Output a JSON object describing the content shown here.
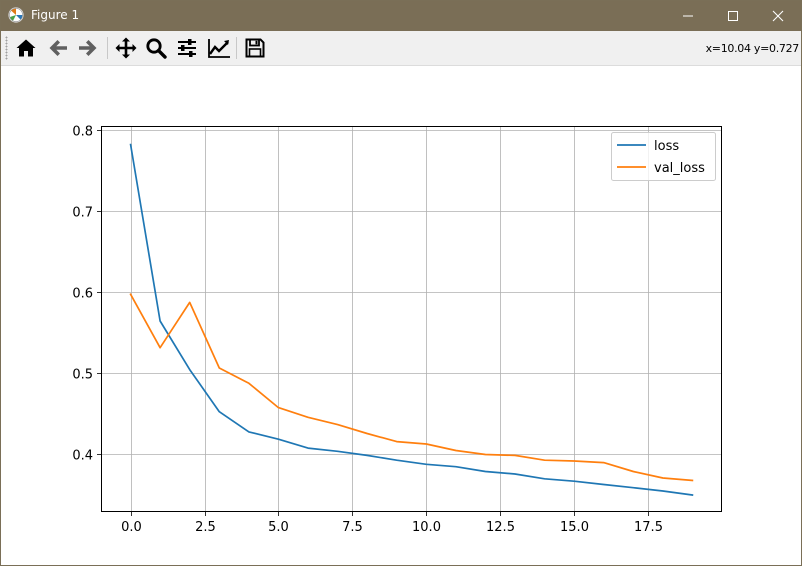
{
  "window": {
    "title": "Figure 1",
    "controls": [
      "minimize",
      "maximize",
      "close"
    ]
  },
  "toolbar": {
    "buttons": [
      {
        "name": "home",
        "icon": "home-icon"
      },
      {
        "name": "back",
        "icon": "arrow-left-icon"
      },
      {
        "name": "forward",
        "icon": "arrow-right-icon"
      },
      {
        "name": "pan",
        "icon": "move-icon"
      },
      {
        "name": "zoom",
        "icon": "zoom-icon"
      },
      {
        "name": "configure-subplots",
        "icon": "sliders-icon"
      },
      {
        "name": "edit-axis",
        "icon": "line-chart-icon"
      },
      {
        "name": "save",
        "icon": "save-icon"
      }
    ],
    "coordinates": "x=10.04 y=0.727"
  },
  "colors": {
    "loss": "#1f77b4",
    "val_loss": "#ff7f0e",
    "grid": "#b0b0b0"
  },
  "chart_data": {
    "type": "line",
    "title": "",
    "xlabel": "",
    "ylabel": "",
    "xlim": [
      -1.0,
      20.0
    ],
    "ylim": [
      0.328,
      0.805
    ],
    "xticks": [
      0.0,
      2.5,
      5.0,
      7.5,
      10.0,
      12.5,
      15.0,
      17.5
    ],
    "xtick_labels": [
      "0.0",
      "2.5",
      "5.0",
      "7.5",
      "10.0",
      "12.5",
      "15.0",
      "17.5"
    ],
    "yticks": [
      0.4,
      0.5,
      0.6,
      0.7,
      0.8
    ],
    "ytick_labels": [
      "0.4",
      "0.5",
      "0.6",
      "0.7",
      "0.8"
    ],
    "grid": true,
    "legend_position": "top-right",
    "x": [
      0,
      1,
      2,
      3,
      4,
      5,
      6,
      7,
      8,
      9,
      10,
      11,
      12,
      13,
      14,
      15,
      16,
      17,
      18,
      19
    ],
    "series": [
      {
        "name": "loss",
        "color": "#1f77b4",
        "values": [
          0.782,
          0.564,
          0.504,
          0.452,
          0.427,
          0.418,
          0.407,
          0.403,
          0.398,
          0.392,
          0.387,
          0.384,
          0.378,
          0.375,
          0.369,
          0.366,
          0.362,
          0.358,
          0.354,
          0.349
        ]
      },
      {
        "name": "val_loss",
        "color": "#ff7f0e",
        "values": [
          0.597,
          0.531,
          0.587,
          0.506,
          0.487,
          0.457,
          0.445,
          0.436,
          0.425,
          0.415,
          0.412,
          0.404,
          0.399,
          0.398,
          0.392,
          0.391,
          0.389,
          0.378,
          0.37,
          0.367
        ]
      }
    ]
  }
}
